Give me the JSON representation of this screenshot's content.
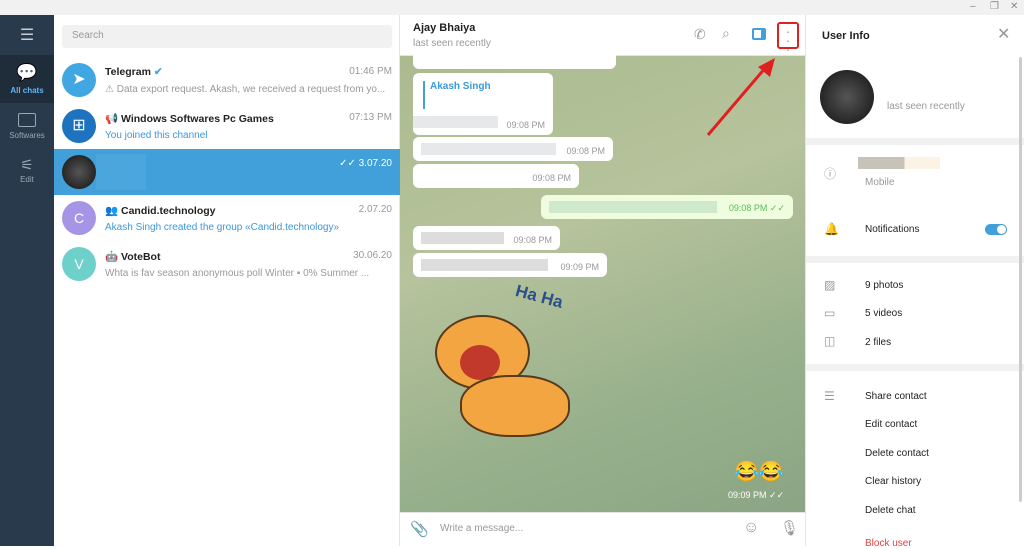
{
  "window": {
    "controls": [
      "minimize",
      "restore",
      "close"
    ]
  },
  "sidebar": {
    "items": [
      {
        "label": "",
        "icon": "menu-icon"
      },
      {
        "label": "All chats",
        "icon": "chats-icon",
        "active": true
      },
      {
        "label": "Softwares",
        "icon": "folder-icon"
      },
      {
        "label": "Edit",
        "icon": "sliders-icon"
      }
    ]
  },
  "chatlist": {
    "search_placeholder": "Search",
    "chats": [
      {
        "name": "Telegram",
        "verified": true,
        "time": "01:46 PM",
        "preview": "⚠ Data export request. Akash, we received a request from yo...",
        "avatar_color": "#40a7e3"
      },
      {
        "name": "Windows Softwares Pc Games",
        "type": "channel",
        "time": "07:13 PM",
        "preview": "You joined this channel",
        "avatar_color": "#1e73be"
      },
      {
        "name": "",
        "time": "3.07.20",
        "preview": "",
        "selected": true,
        "avatar_color": "#222222"
      },
      {
        "name": "Candid.technology",
        "type": "group",
        "time": "2.07.20",
        "preview": "Akash Singh created the group «Candid.technology»",
        "avatar_letter": "C",
        "avatar_color": "#a695e7"
      },
      {
        "name": "VoteBot",
        "type": "bot",
        "time": "30.06.20",
        "preview": "Whta is fav season anonymous poll  Winter  ▪  0%  Summer ...",
        "avatar_letter": "V",
        "avatar_color": "#6ed0cb"
      }
    ]
  },
  "chat": {
    "title": "Ajay Bhaiya",
    "status": "last seen recently",
    "reply_name": "Akash Singh",
    "messages": [
      {
        "time": "09:08 PM",
        "dir": "in"
      },
      {
        "time": "09:08 PM",
        "dir": "in"
      },
      {
        "time": "09:08 PM",
        "dir": "in"
      },
      {
        "time": "09:08 PM",
        "dir": "out"
      },
      {
        "time": "09:08 PM",
        "dir": "in"
      },
      {
        "time": "09:09 PM",
        "dir": "in"
      }
    ],
    "sticker_text": "Ha Ha",
    "last_time": "09:09 PM",
    "input_placeholder": "Write a message...",
    "accent": "#419fd9",
    "highlight_color": "#e02020"
  },
  "info": {
    "title": "User Info",
    "status": "last seen recently",
    "phone_label": "Mobile",
    "notifications_label": "Notifications",
    "notifications_on": true,
    "media": [
      "9 photos",
      "5 videos",
      "2 files"
    ],
    "actions": [
      "Share contact",
      "Edit contact",
      "Delete contact",
      "Clear history",
      "Delete chat"
    ],
    "block": "Block user"
  }
}
